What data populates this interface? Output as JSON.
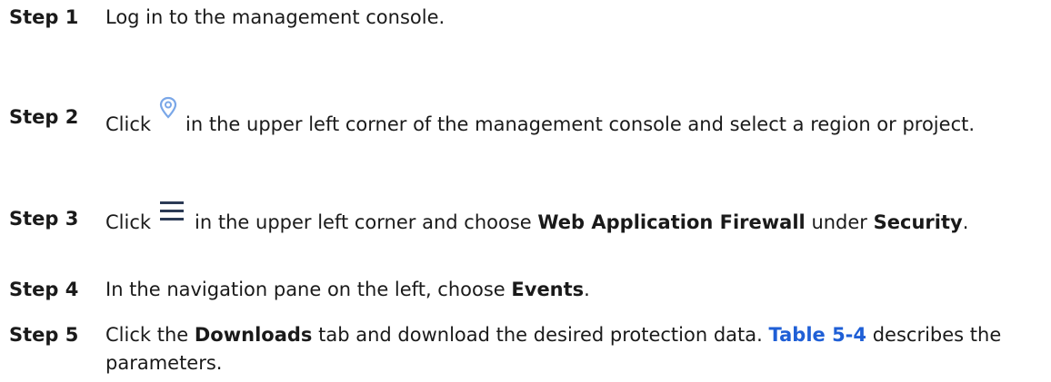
{
  "steps": [
    {
      "label": "Step 1",
      "parts": [
        "Log in to the management console."
      ]
    },
    {
      "label": "Step 2",
      "before": "Click",
      "icon": "location-pin-icon",
      "after": "in the upper left corner of the management console and select a region or project."
    },
    {
      "label": "Step 3",
      "before": "Click",
      "icon": "hamburger-menu-icon",
      "mid": "in the upper left corner and choose",
      "service": "Web Application Firewall",
      "under": "under",
      "category": "Security",
      "end": "."
    },
    {
      "label": "Step 4",
      "text": "In the navigation pane on the left, choose",
      "target": "Events",
      "end": "."
    },
    {
      "label": "Step 5",
      "before": "Click the",
      "tab": "Downloads",
      "mid": "tab and download the desired protection data.",
      "table_ref": "Table 5-4",
      "after": "describes the parameters."
    }
  ],
  "colors": {
    "text": "#1a1a1a",
    "link": "#1f5fd6",
    "icon_blue": "#7aa7e8",
    "icon_dark": "#2b3a55"
  }
}
